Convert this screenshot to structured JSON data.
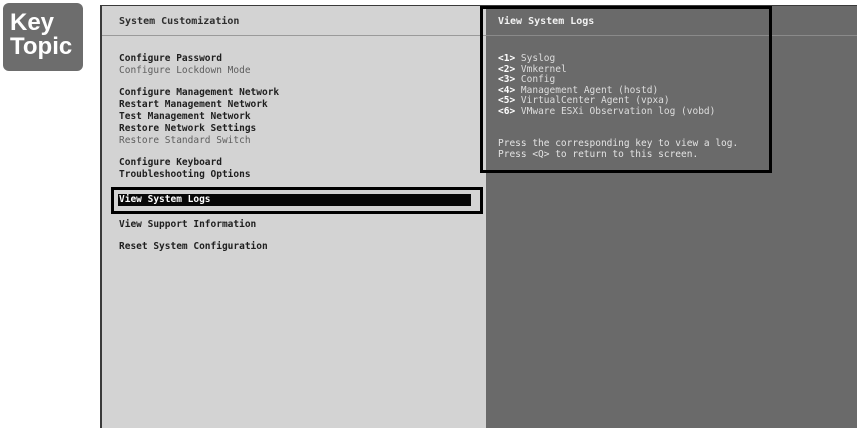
{
  "badge": {
    "line1": "Key",
    "line2": "Topic"
  },
  "left": {
    "title": "System Customization",
    "groups": [
      [
        {
          "label": "Configure Password",
          "dim": false
        },
        {
          "label": "Configure Lockdown Mode",
          "dim": true
        }
      ],
      [
        {
          "label": "Configure Management Network",
          "dim": false
        },
        {
          "label": "Restart Management Network",
          "dim": false
        },
        {
          "label": "Test Management Network",
          "dim": false
        },
        {
          "label": "Restore Network Settings",
          "dim": false
        },
        {
          "label": "Restore Standard Switch",
          "dim": true
        }
      ],
      [
        {
          "label": "Configure Keyboard",
          "dim": false
        },
        {
          "label": "Troubleshooting Options",
          "dim": false
        }
      ],
      [
        {
          "label": "View System Logs",
          "dim": false,
          "selected": true
        }
      ],
      [
        {
          "label": "View Support Information",
          "dim": false
        }
      ],
      [
        {
          "label": "Reset System Configuration",
          "dim": false
        }
      ]
    ]
  },
  "right": {
    "title": "View System Logs",
    "logs": [
      {
        "key": "<1>",
        "label": "Syslog"
      },
      {
        "key": "<2>",
        "label": "Vmkernel"
      },
      {
        "key": "<3>",
        "label": "Config"
      },
      {
        "key": "<4>",
        "label": "Management Agent (hostd)"
      },
      {
        "key": "<5>",
        "label": "VirtualCenter Agent (vpxa)"
      },
      {
        "key": "<6>",
        "label": "VMware ESXi Observation log (vobd)"
      }
    ],
    "hint1": "Press the corresponding key to view a log.",
    "hint2": "Press <Q> to return to this screen."
  }
}
